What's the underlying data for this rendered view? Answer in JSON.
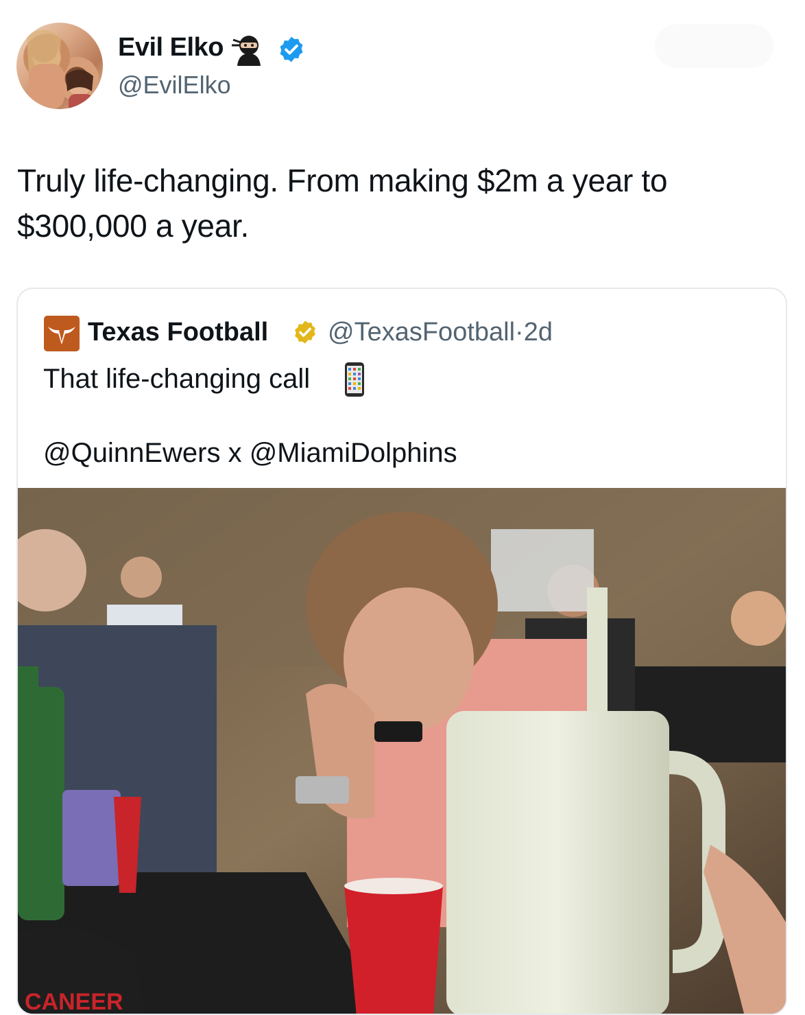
{
  "author": {
    "display_name": "Evil Elko",
    "handle": "@EvilElko",
    "emoji_icon": "ninja-emoji-icon",
    "verified": true
  },
  "tweet": {
    "text": "Truly life-changing. From making $2m a year to $300,000 a year."
  },
  "quote": {
    "display_name": "Texas Football",
    "handle": "@TexasFootball",
    "separator": "·",
    "age": "2d",
    "text_line1": "That life-changing call",
    "text_line1_icon": "mobile-phone-icon",
    "text_line2": "@QuinnEwers x @MiamiDolphins",
    "photo_caption_text": "CANEER"
  },
  "colors": {
    "verified_blue": "#1d9bf0",
    "gold_badge": "#e2b719",
    "handle_grey": "#536471",
    "brand_orange": "#bf5a1f"
  }
}
